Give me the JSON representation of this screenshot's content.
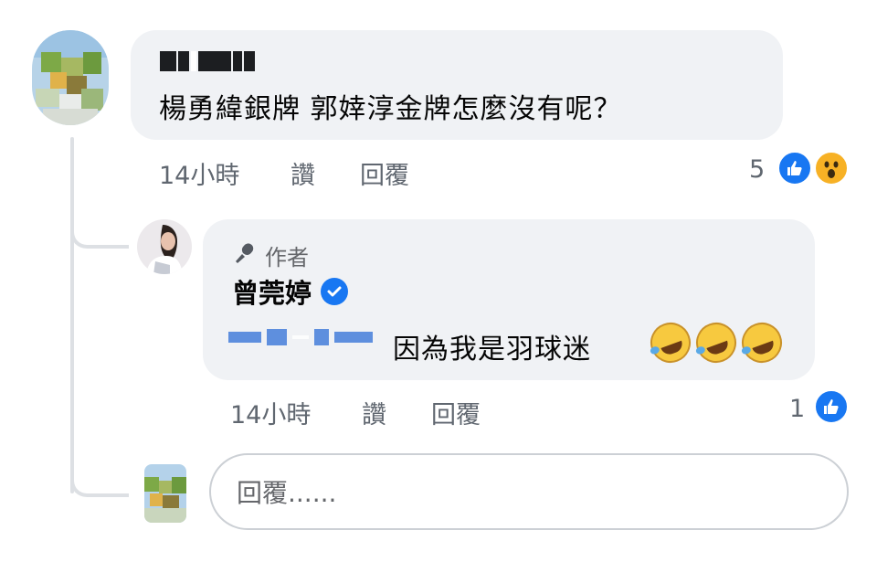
{
  "comment": {
    "author_name_blurred": "WH Chan",
    "text": "楊勇緯銀牌 郭婞淳金牌怎麼沒有呢？",
    "time": "14小時",
    "like_label": "讚",
    "reply_label": "回覆",
    "reaction_count": "5",
    "reactions": [
      "like-icon",
      "wow-icon"
    ]
  },
  "reply": {
    "badge_label": "作者",
    "badge_icon": "microphone-icon",
    "author_name": "曾莞婷",
    "verified_icon": "verified-badge-icon",
    "text": "因為我是羽球迷",
    "emojis": [
      "rolling-on-floor-laughing-icon",
      "rolling-on-floor-laughing-icon",
      "rolling-on-floor-laughing-icon"
    ],
    "time": "14小時",
    "like_label": "讚",
    "reply_label": "回覆",
    "reaction_count": "1",
    "reactions": [
      "like-icon"
    ]
  },
  "reply_box": {
    "placeholder": "回覆......"
  },
  "colors": {
    "bubble_bg": "#f0f2f5",
    "meta_text": "#606770",
    "like_blue": "#1877f2",
    "wow_yellow": "#f7b125"
  }
}
